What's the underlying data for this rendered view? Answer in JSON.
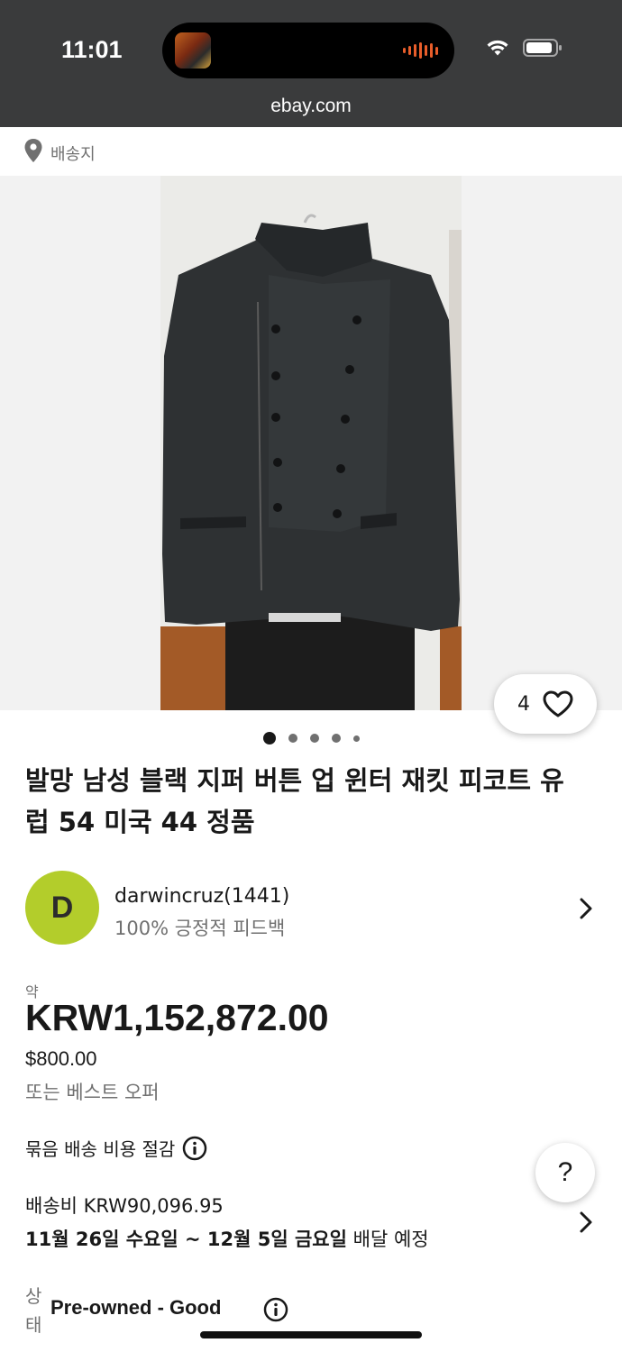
{
  "status_bar": {
    "time": "11:01",
    "url": "ebay.com"
  },
  "location": {
    "label": "배송지"
  },
  "gallery": {
    "favorite_count": "4",
    "image_count": 5,
    "active_index": 0
  },
  "listing": {
    "title": "발망 남성 블랙 지퍼 버튼 업 윈터 재킷 피코트 유럽 54 미국 44 정품"
  },
  "seller": {
    "initial": "D",
    "avatar_color": "#b3cd2b",
    "name": "darwincruz(1441)",
    "feedback": "100% 긍정적 피드백"
  },
  "price": {
    "approx_label": "약",
    "krw": "KRW1,152,872.00",
    "usd": "$800.00",
    "best_offer": "또는 베스트 오퍼"
  },
  "shipping": {
    "combined": "묶음 배송 비용 절감",
    "cost": "배송비 KRW90,096.95",
    "date_bold": "11월 26일 수요일 ~ 12월 5일 금요일",
    "date_rest": " 배달 예정"
  },
  "condition": {
    "label": "상태",
    "value": "Pre-owned - Good"
  },
  "help": {
    "label": "?"
  },
  "colors": {
    "status_bar_bg": "#3a3b3c",
    "text": "#191919",
    "muted": "#707070"
  }
}
